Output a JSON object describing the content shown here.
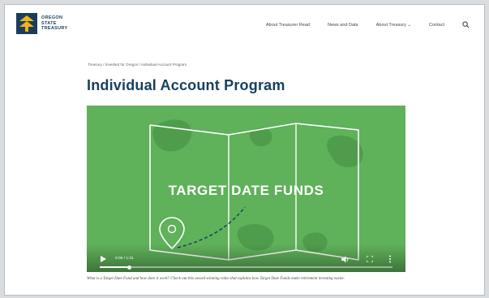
{
  "brand": {
    "name_line1": "OREGON",
    "name_line2": "STATE",
    "name_line3": "TREASURY",
    "colors": {
      "navy": "#1b3d5c",
      "gold": "#f2b21b",
      "title": "#15415f",
      "video_green": "#5fb15a"
    }
  },
  "nav": {
    "items": [
      {
        "label": "About Treasurer Read"
      },
      {
        "label": "News and Data"
      },
      {
        "label": "About Treasury ⌄"
      },
      {
        "label": "Contact"
      }
    ],
    "search_icon": "search-icon"
  },
  "breadcrumb": "Treasury / Invested for Oregon / Individual Account Program",
  "page": {
    "title": "Individual Account Program"
  },
  "video": {
    "title_text": "TARGET DATE FUNDS",
    "time": "0:06 / 1:31",
    "progress": 0.1,
    "icons": [
      "play-icon",
      "volume-icon",
      "fullscreen-icon",
      "more-icon",
      "location-pin-icon"
    ]
  },
  "caption": "What is a Target Date Fund and how does it work? Check out this award-winning video that explains how Target Date Funds make retirement investing easier."
}
